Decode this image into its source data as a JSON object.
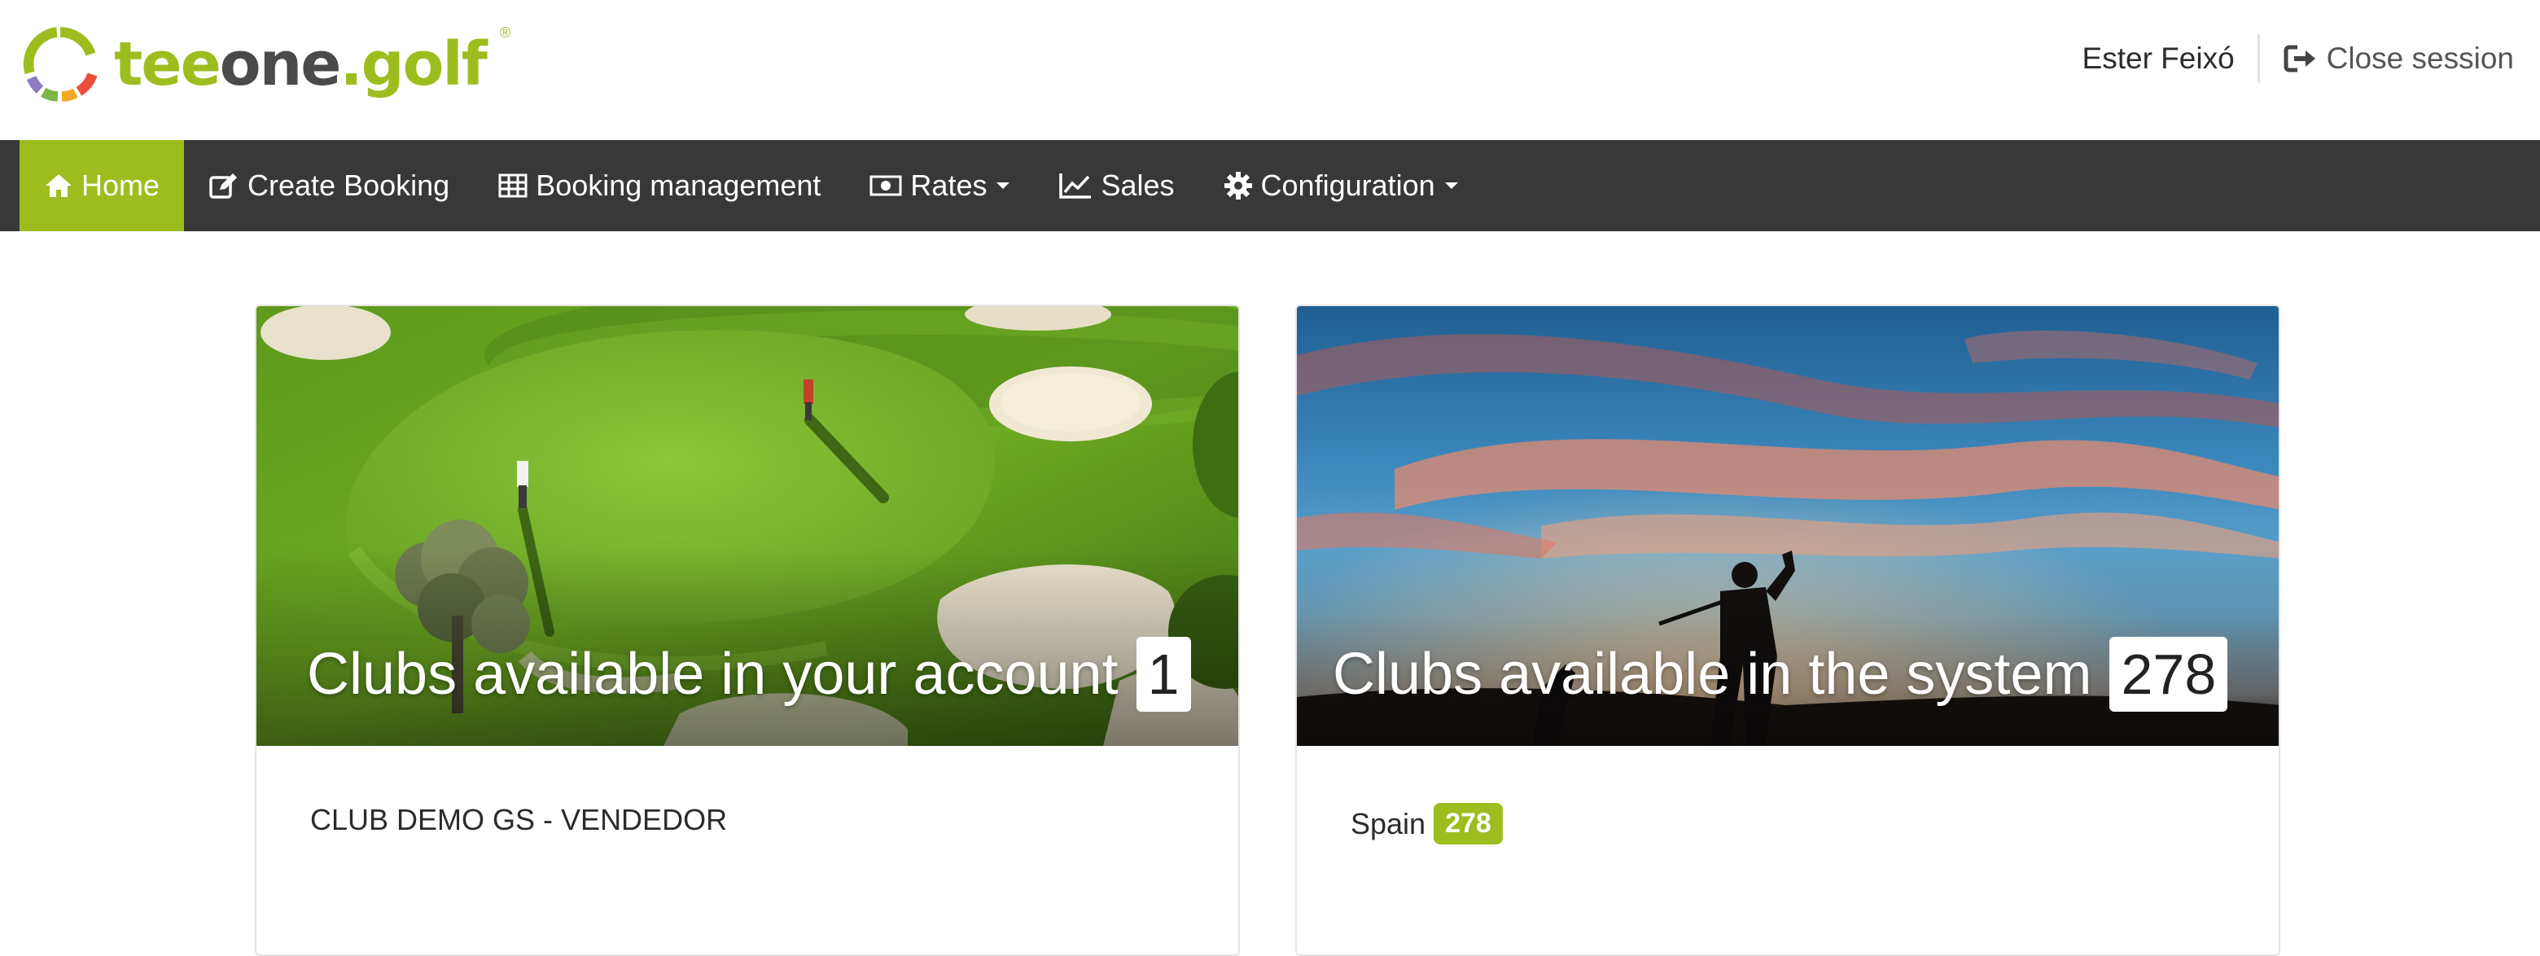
{
  "brand": {
    "logo_text_tee": "tee",
    "logo_text_one": "one",
    "logo_text_golf": ".golf",
    "logo_registered": "®",
    "primary_color": "#9dbd1f",
    "dark_color": "#383838"
  },
  "header": {
    "user_name": "Ester Feixó",
    "close_session_label": "Close session",
    "close_session_icon": "sign-out-icon"
  },
  "navbar": {
    "items": [
      {
        "label": "Home",
        "icon": "home-icon",
        "active": true
      },
      {
        "label": "Create Booking",
        "icon": "edit-icon"
      },
      {
        "label": "Booking management",
        "icon": "table-icon"
      },
      {
        "label": "Rates",
        "icon": "money-icon",
        "dropdown": true
      },
      {
        "label": "Sales",
        "icon": "line-chart-icon"
      },
      {
        "label": "Configuration",
        "icon": "gear-icon",
        "dropdown": true
      }
    ]
  },
  "cards": {
    "account": {
      "title": "Clubs available in your account",
      "count": "1",
      "image": "golf-course-aerial",
      "clubs": [
        "CLUB DEMO GS - VENDEDOR"
      ]
    },
    "system": {
      "title": "Clubs available in the system",
      "count": "278",
      "image": "golfer-sunset-silhouette",
      "countries": [
        {
          "name": "Spain",
          "count": "278"
        }
      ]
    }
  }
}
